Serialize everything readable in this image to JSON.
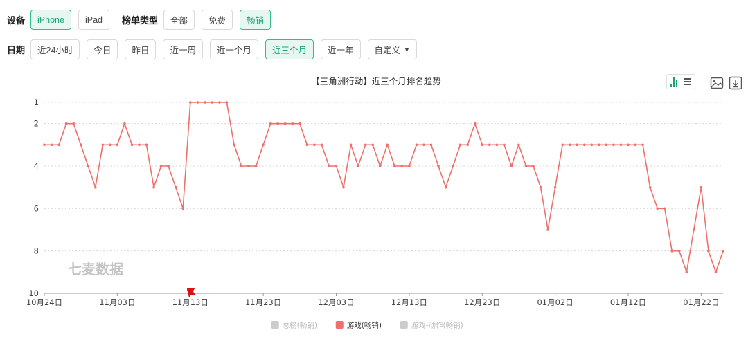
{
  "filters": {
    "device_label": "设备",
    "device_options": [
      "iPhone",
      "iPad"
    ],
    "list_type_label": "榜单类型",
    "list_type_options": [
      "全部",
      "免费",
      "畅销"
    ],
    "date_label": "日期",
    "date_options": [
      "近24小时",
      "今日",
      "昨日",
      "近一周",
      "近一个月",
      "近三个月",
      "近一年"
    ],
    "custom_label": "自定义",
    "selected_device": "iPhone",
    "selected_list_type": "畅销",
    "selected_date": "近三个月"
  },
  "toolbar": {
    "toggle_icons": [
      "bar-chart-icon",
      "list-icon"
    ],
    "image_icon": "image-icon",
    "download_icon": "download-icon"
  },
  "watermark": "七麦数据",
  "colors": {
    "accent": "#2bbf8f",
    "accent_bg": "#e6f7f1",
    "series_line": "#ef6f6c",
    "legend_inactive": "#cccccc",
    "marker": "#dd1111"
  },
  "chart_data": {
    "type": "line",
    "title": "【三角洲行动】近三个月排名趋势",
    "xlabel": "",
    "ylabel": "",
    "x_tick_labels": [
      "10月24日",
      "11月03日",
      "11月13日",
      "11月23日",
      "12月03日",
      "12月13日",
      "12月23日",
      "01月02日",
      "01月12日",
      "01月22日"
    ],
    "x_range": [
      "10月24日",
      "01月22日"
    ],
    "y_ticks": [
      1,
      2,
      4,
      6,
      8,
      10
    ],
    "ylim": [
      1,
      10
    ],
    "y_inverted": true,
    "grid": true,
    "legend_position": "bottom",
    "legend": [
      {
        "name": "总榜(畅销)",
        "active": false
      },
      {
        "name": "游戏(畅销)",
        "active": true
      },
      {
        "name": "游戏-动作(畅销)",
        "active": false
      }
    ],
    "series": [
      {
        "name": "游戏(畅销)",
        "values": [
          3,
          3,
          3,
          2,
          2,
          3,
          4,
          5,
          3,
          3,
          3,
          2,
          3,
          3,
          3,
          5,
          4,
          4,
          5,
          6,
          1,
          1,
          1,
          1,
          1,
          1,
          3,
          4,
          4,
          4,
          3,
          2,
          2,
          2,
          2,
          2,
          3,
          3,
          3,
          4,
          4,
          5,
          3,
          4,
          3,
          3,
          4,
          3,
          4,
          4,
          4,
          3,
          3,
          3,
          4,
          5,
          4,
          3,
          3,
          2,
          3,
          3,
          3,
          3,
          4,
          3,
          4,
          4,
          5,
          7,
          5,
          3,
          3,
          3,
          3,
          3,
          3,
          3,
          3,
          3,
          3,
          3,
          3,
          5,
          6,
          6,
          8,
          8,
          9,
          7,
          5,
          8,
          9,
          8
        ]
      }
    ],
    "annotations": [
      {
        "type": "flag",
        "label": "11月13日"
      }
    ]
  }
}
